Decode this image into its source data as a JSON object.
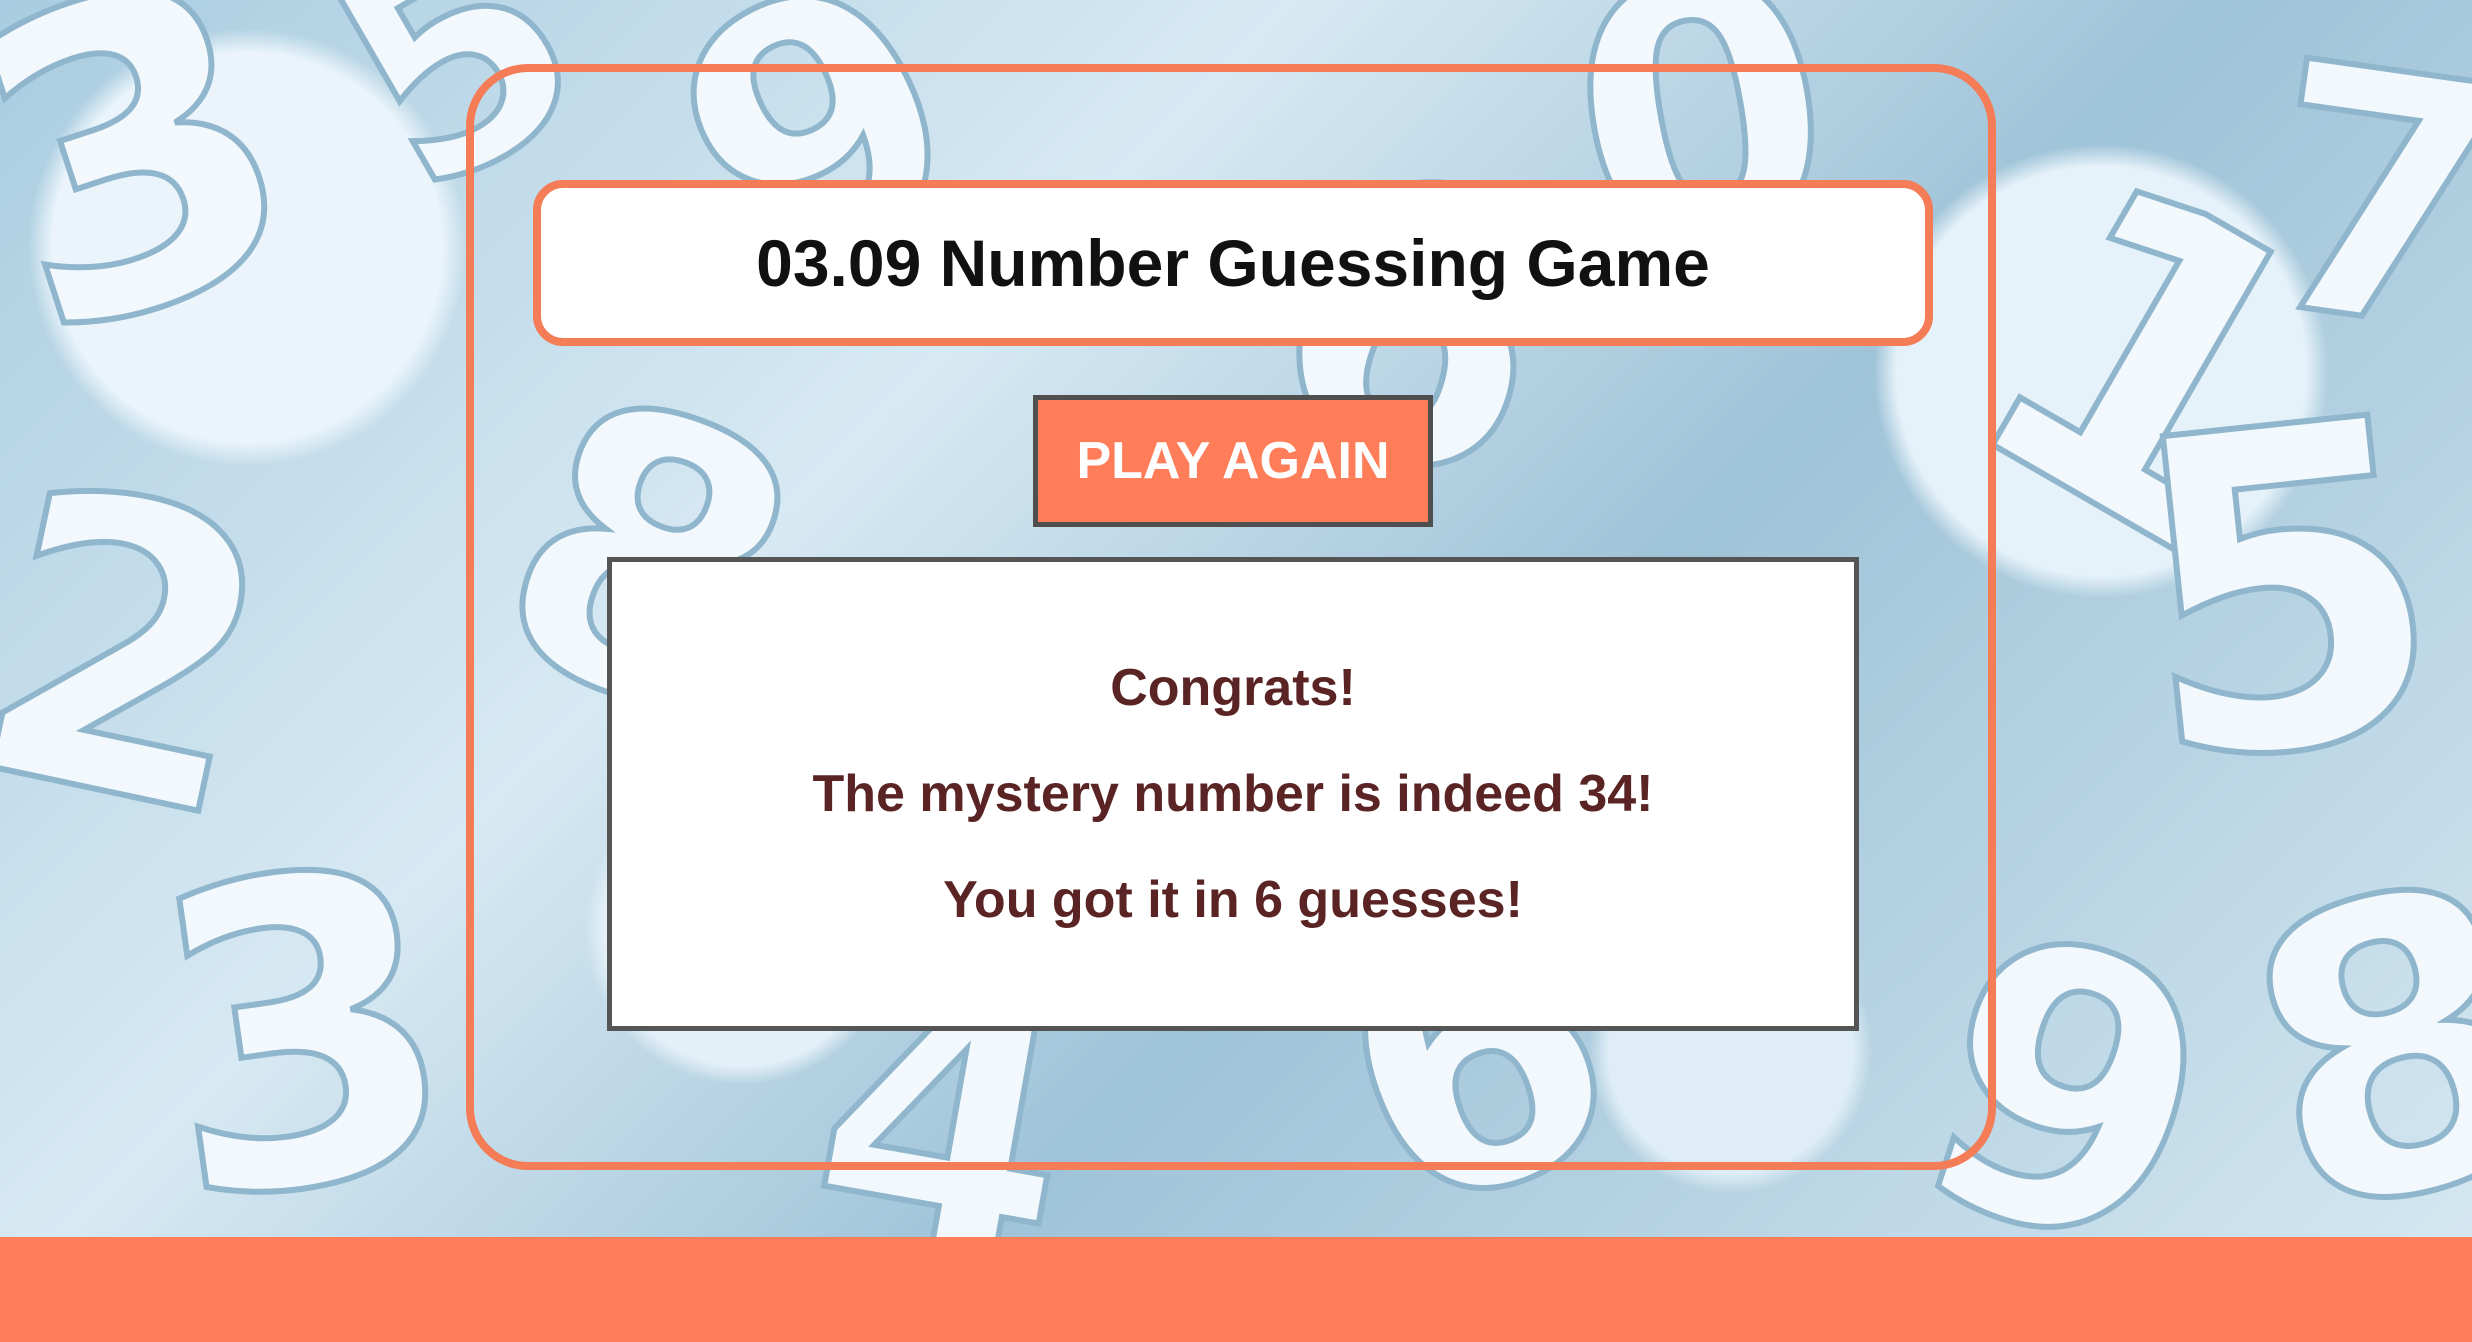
{
  "game": {
    "title": "03.09 Number Guessing Game",
    "play_again_label": "PLAY AGAIN",
    "messages": {
      "congrats": "Congrats!",
      "mystery": "The mystery number is indeed 34!",
      "guesses": "You got it in 6 guesses!"
    }
  },
  "colors": {
    "accent": "#f47c56",
    "button_bg": "#ff7d58",
    "message_text": "#5a2424",
    "button_border": "#4f4f4f"
  },
  "background": {
    "icon": "scattered-numbers-background"
  }
}
